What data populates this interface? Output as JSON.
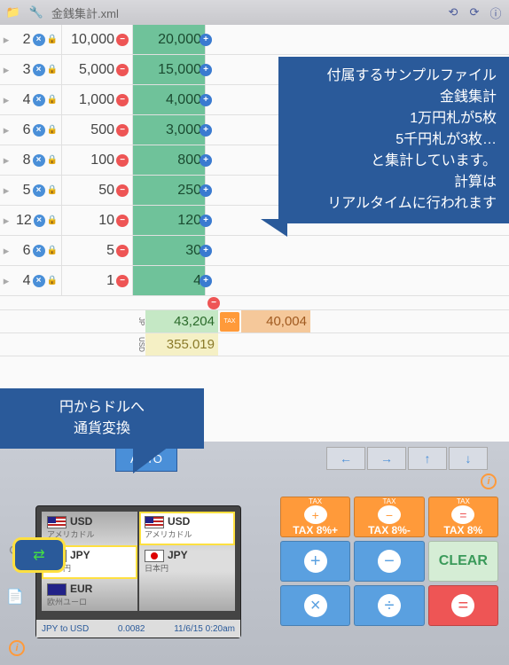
{
  "header": {
    "title": "金銭集計.xml"
  },
  "rows": [
    {
      "count": 2,
      "denom": "10,000",
      "sub": "20,000"
    },
    {
      "count": 3,
      "denom": "5,000",
      "sub": "15,000"
    },
    {
      "count": 4,
      "denom": "1,000",
      "sub": "4,000"
    },
    {
      "count": 6,
      "denom": "500",
      "sub": "3,000"
    },
    {
      "count": 8,
      "denom": "100",
      "sub": "800"
    },
    {
      "count": 5,
      "denom": "50",
      "sub": "250"
    },
    {
      "count": 12,
      "denom": "10",
      "sub": "120"
    },
    {
      "count": 6,
      "denom": "5",
      "sub": "30"
    },
    {
      "count": 4,
      "denom": "1",
      "sub": "4"
    }
  ],
  "totals": {
    "jp_label": "JP",
    "jp": "43,204",
    "tax_label": "TAX",
    "tax": "40,004",
    "usd_label": "USD",
    "usd": "355.019"
  },
  "callout1": {
    "l1": "付属するサンプルファイル",
    "l2": "金銭集計",
    "l3": "1万円札が5枚",
    "l4": "5千円札が3枚…",
    "l5": "と集計しています。",
    "l6": "計算は",
    "l7": "リアルタイムに行われます"
  },
  "callout2": {
    "l1": "円からドルへ",
    "l2": "通貨変換"
  },
  "auto": "AUTO",
  "currency": {
    "left": [
      {
        "code": "USD",
        "name": "アメリカドル",
        "flag": "us"
      },
      {
        "code": "JPY",
        "name": "日本円",
        "flag": "jp"
      },
      {
        "code": "EUR",
        "name": "欧州ユーロ",
        "flag": "eu"
      }
    ],
    "right": [
      {
        "code": "USD",
        "name": "アメリカドル",
        "flag": "us"
      },
      {
        "code": "JPY",
        "name": "日本円",
        "flag": "jp"
      }
    ],
    "pair": "JPY to USD",
    "rate": "0.0082",
    "time": "11/6/15 0:20am"
  },
  "keypad": {
    "tax_plus_small": "TAX",
    "tax_plus": "TAX 8%+",
    "tax_minus_small": "TAX",
    "tax_minus": "TAX 8%-",
    "tax_eq_small": "TAX",
    "tax_eq": "TAX 8%",
    "plus": "+",
    "minus": "−",
    "clear": "CLEAR",
    "mult": "×",
    "div": "÷",
    "eq": "="
  }
}
